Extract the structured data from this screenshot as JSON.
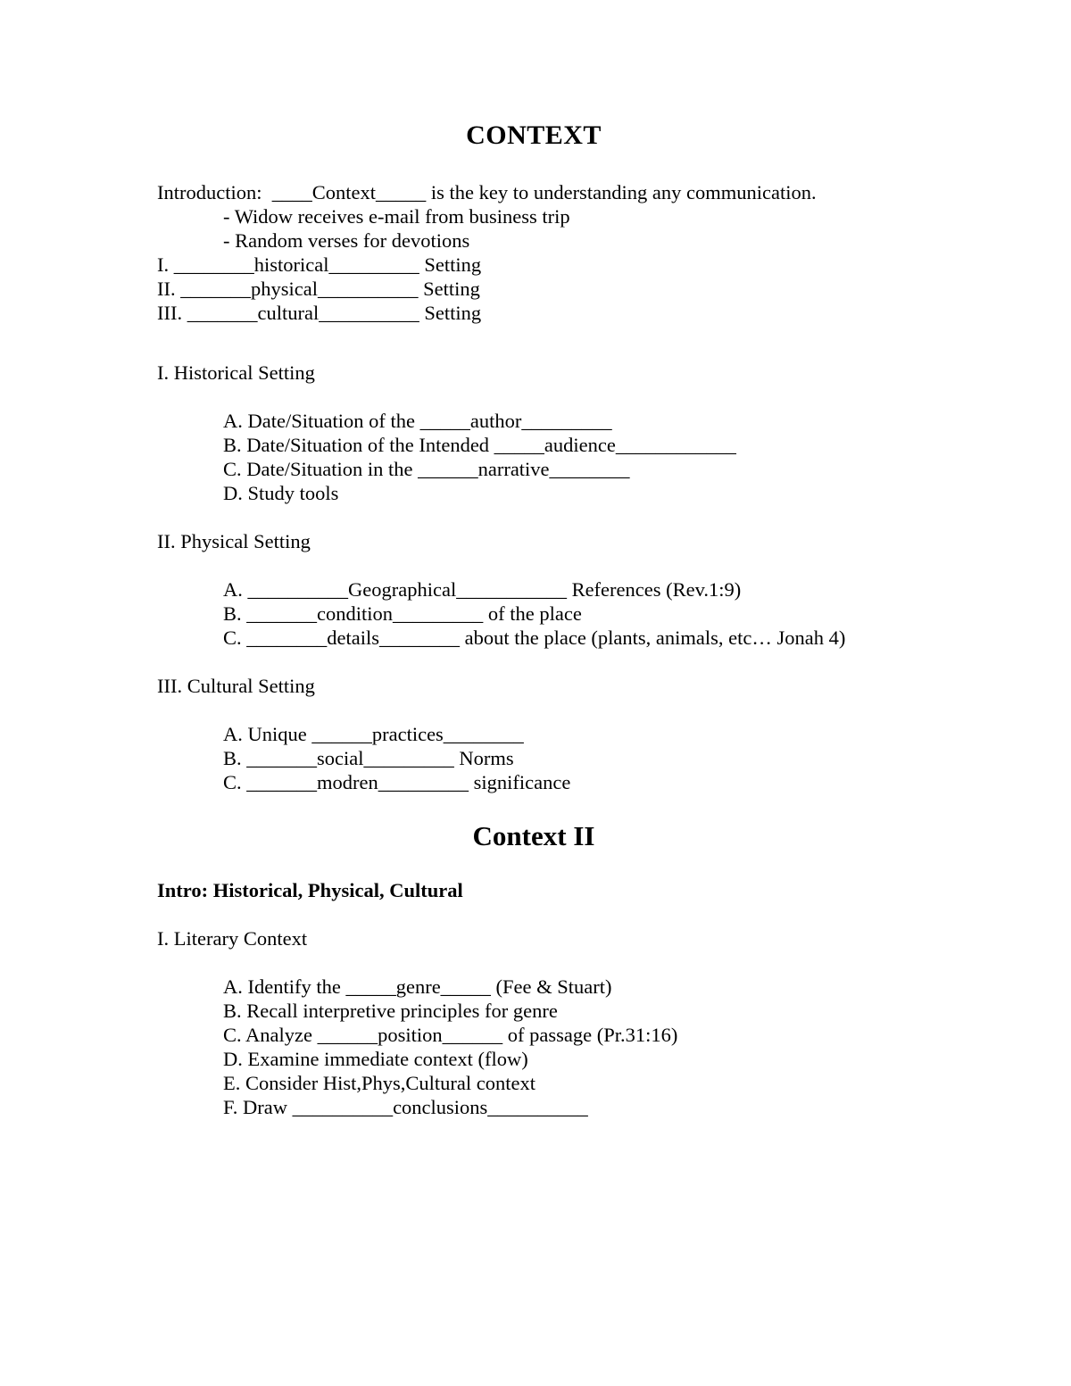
{
  "document": {
    "title": "CONTEXT",
    "title_2": "Context II",
    "intro": {
      "label": "Introduction:",
      "full_line": "Introduction:  ____Context_____ is the key to understanding any communication.",
      "bullets": [
        "- Widow receives e-mail from business trip",
        "- Random verses for devotions"
      ]
    },
    "outline_summary": [
      "I. ________historical_________ Setting",
      "II. _______physical__________ Setting",
      "III. _______cultural__________ Setting"
    ],
    "sections": [
      {
        "heading": "I. Historical Setting",
        "items": [
          "A. Date/Situation of the _____author_________",
          "B. Date/Situation of the Intended _____audience____________",
          "C. Date/Situation in the ______narrative________",
          "D. Study tools"
        ]
      },
      {
        "heading": "II. Physical Setting",
        "items": [
          "A. __________Geographical___________ References (Rev.1:9)",
          "B. _______condition_________ of the place",
          "C. ________details________ about the place (plants, animals, etc… Jonah 4)"
        ]
      },
      {
        "heading": "III. Cultural Setting",
        "items": [
          "A. Unique ______practices________",
          "B. _______social_________ Norms",
          "C. _______modren_________ significance"
        ]
      }
    ],
    "part_two": {
      "intro_bold": "Intro: Historical, Physical, Cultural",
      "section": {
        "heading": "I. Literary Context",
        "items": [
          "A. Identify the _____genre_____ (Fee & Stuart)",
          "B. Recall interpretive principles for genre",
          "C. Analyze ______position______ of passage (Pr.31:16)",
          "D. Examine immediate context (flow)",
          "E. Consider Hist,Phys,Cultural context",
          "F. Draw __________conclusions__________"
        ]
      }
    }
  }
}
